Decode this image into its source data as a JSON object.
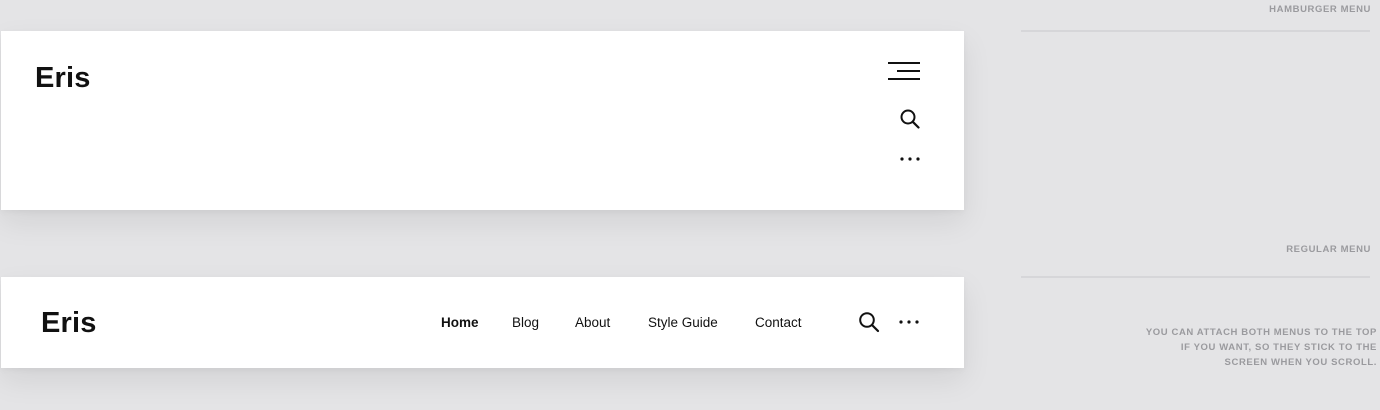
{
  "colors": {
    "background": "#e4e4e6",
    "card": "#ffffff",
    "text": "#111111",
    "annotation": "#9a9a9e"
  },
  "hamburger_header": {
    "logo": "Eris",
    "icons": [
      "hamburger-menu-icon",
      "search-icon",
      "more-horizontal-icon"
    ]
  },
  "regular_header": {
    "logo": "Eris",
    "nav": [
      {
        "label": "Home",
        "active": true
      },
      {
        "label": "Blog",
        "active": false
      },
      {
        "label": "About",
        "active": false
      },
      {
        "label": "Style Guide",
        "active": false
      },
      {
        "label": "Contact",
        "active": false
      }
    ],
    "icons": [
      "search-icon",
      "more-horizontal-icon"
    ]
  },
  "annotations": {
    "hamburger_label": "HAMBURGER MENU",
    "regular_label": "REGULAR MENU",
    "note": "YOU CAN ATTACH BOTH MENUS TO THE TOP IF YOU WANT, SO THEY STICK TO THE SCREEN WHEN YOU SCROLL."
  }
}
